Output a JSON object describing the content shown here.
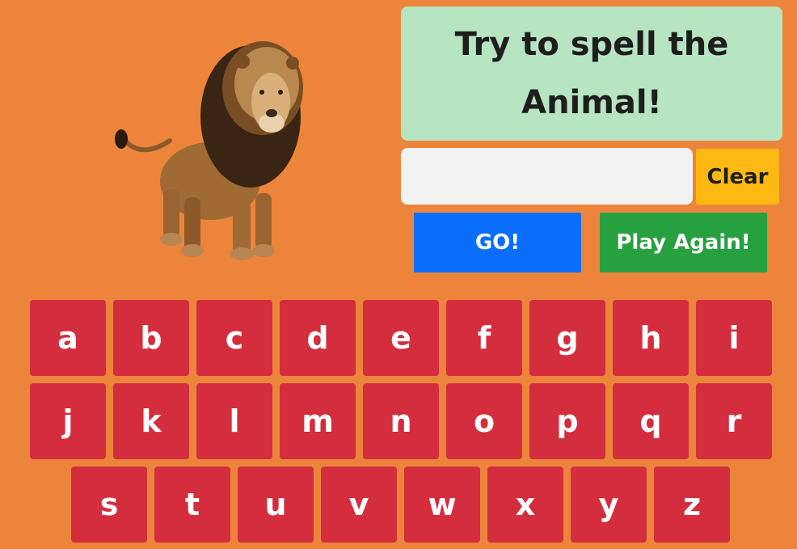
{
  "prompt": {
    "text": "Try to spell the Animal!"
  },
  "animal": {
    "name": "lion"
  },
  "input": {
    "value": ""
  },
  "buttons": {
    "clear": "Clear",
    "go": "GO!",
    "play_again": "Play Again!"
  },
  "keyboard": {
    "rows": [
      [
        "a",
        "b",
        "c",
        "d",
        "e",
        "f",
        "g",
        "h",
        "i"
      ],
      [
        "j",
        "k",
        "l",
        "m",
        "n",
        "o",
        "p",
        "q",
        "r"
      ],
      [
        "s",
        "t",
        "u",
        "v",
        "w",
        "x",
        "y",
        "z"
      ]
    ]
  },
  "colors": {
    "background": "#EC853B",
    "prompt_bg": "#B7E5C2",
    "clear": "#FDB912",
    "go": "#0A6EFA",
    "play_again": "#27A040",
    "key": "#D42D3D"
  }
}
